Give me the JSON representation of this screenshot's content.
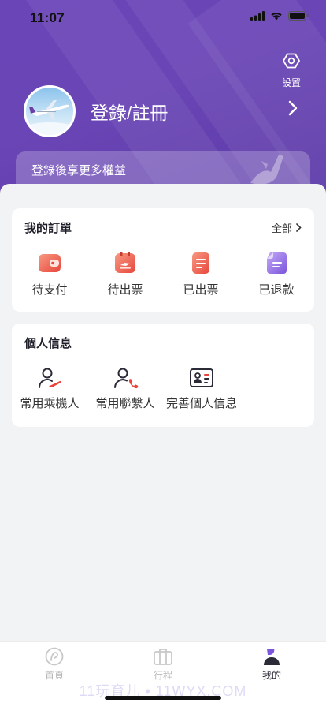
{
  "status_bar": {
    "time": "11:07"
  },
  "header": {
    "settings_label": "設置",
    "login_label": "登錄/註冊",
    "benefit_text": "登錄後享更多權益"
  },
  "orders": {
    "title": "我的訂單",
    "all_label": "全部",
    "items": [
      {
        "label": "待支付",
        "icon": "wallet-icon"
      },
      {
        "label": "待出票",
        "icon": "calendar-ticket-icon"
      },
      {
        "label": "已出票",
        "icon": "document-icon"
      },
      {
        "label": "已退款",
        "icon": "refund-icon"
      }
    ]
  },
  "personal": {
    "title": "個人信息",
    "items": [
      {
        "label": "常用乘機人",
        "icon": "passenger-icon"
      },
      {
        "label": "常用聯繫人",
        "icon": "contact-icon"
      },
      {
        "label": "完善個人信息",
        "icon": "id-card-icon"
      }
    ]
  },
  "tabbar": {
    "items": [
      {
        "label": "首頁",
        "icon": "home-icon"
      },
      {
        "label": "行程",
        "icon": "luggage-icon"
      },
      {
        "label": "我的",
        "icon": "profile-icon"
      }
    ],
    "active": "我的"
  },
  "watermark": "11玩育儿 • 11WYX.COM",
  "colors": {
    "header": "#6a45b8",
    "accent_red": "#ef5a4a",
    "accent_purple": "#8a6ae0"
  }
}
